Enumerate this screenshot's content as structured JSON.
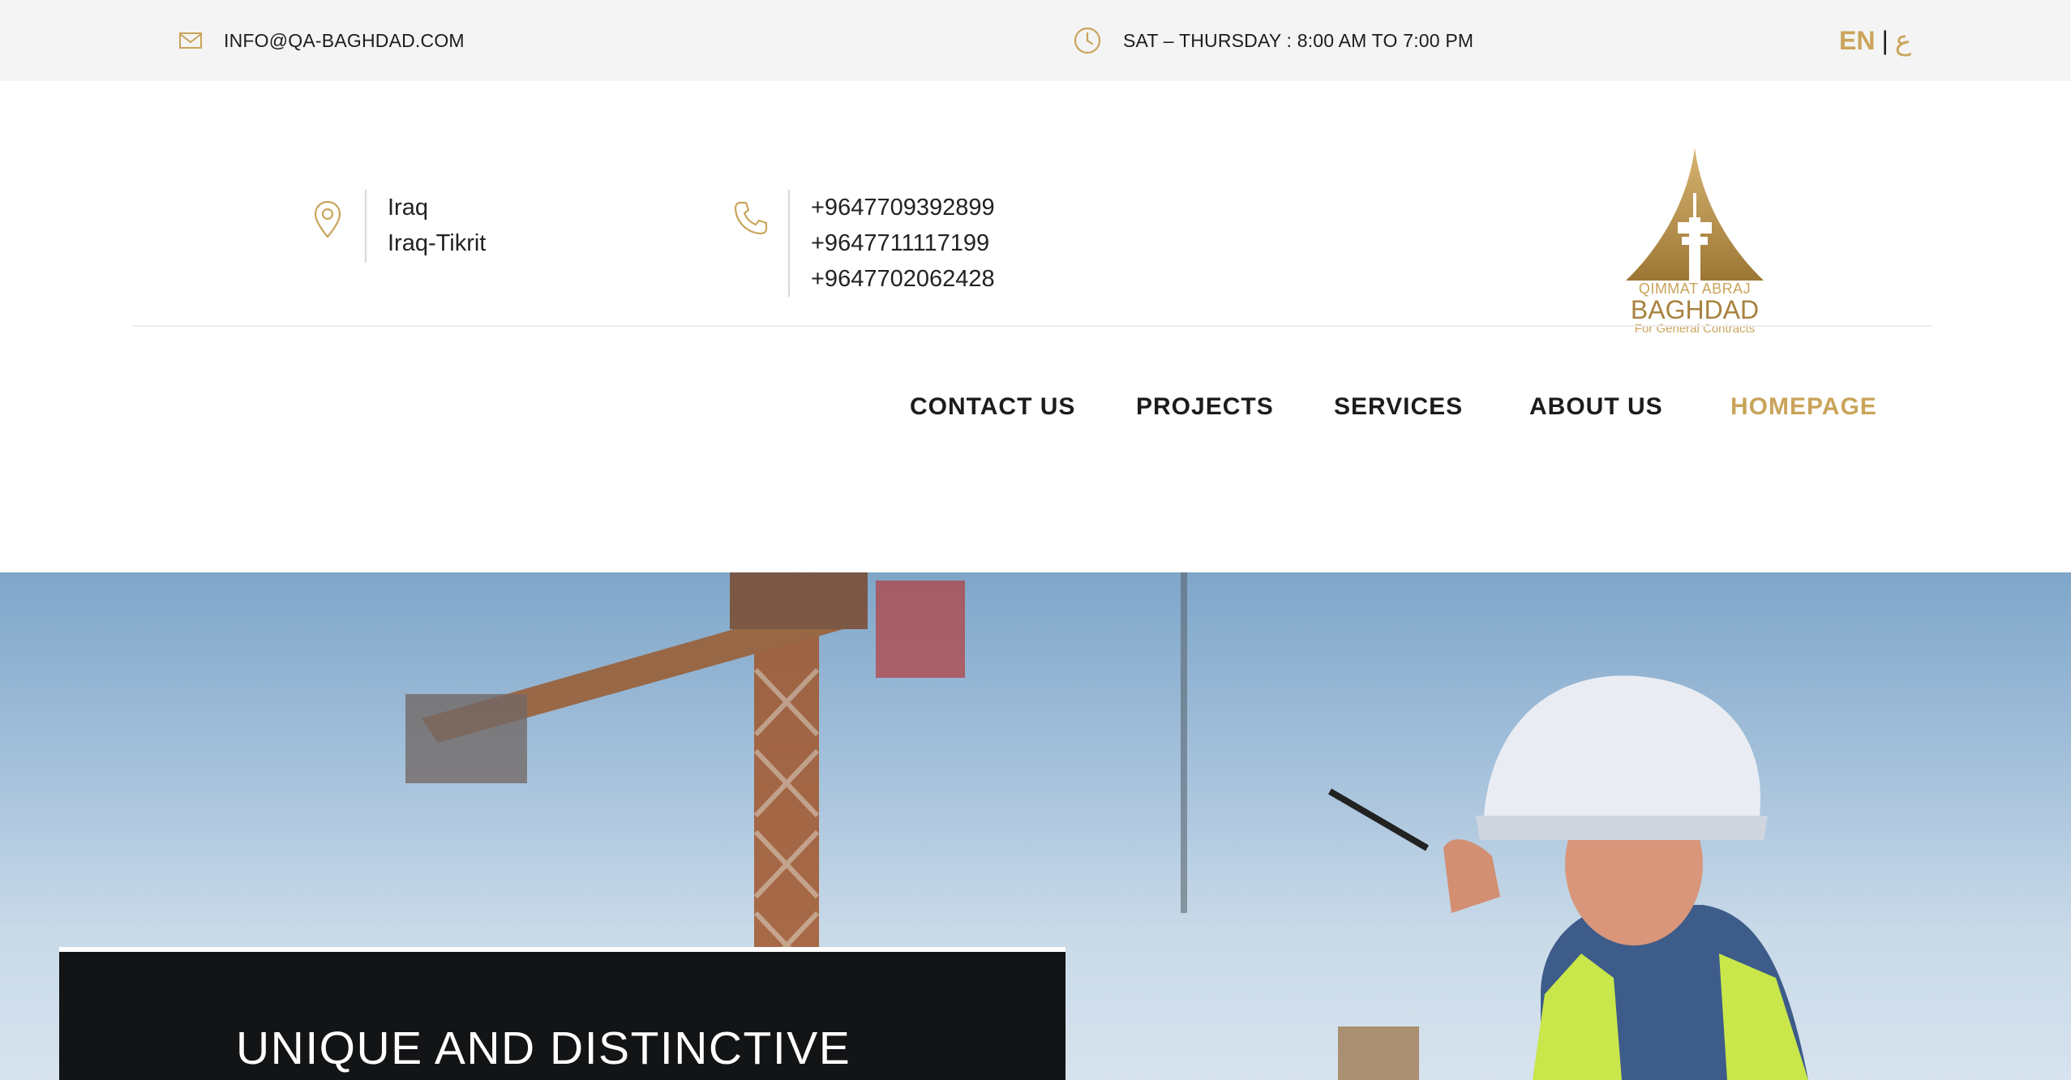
{
  "topbar": {
    "email": "INFO@QA-BAGHDAD.COM",
    "hours": "SAT – THURSDAY : 8:00 AM TO 7:00 PM",
    "lang_en": "EN",
    "lang_separator": "|",
    "lang_ar": "ع",
    "icons": {
      "email": "envelope-icon",
      "hours": "clock-icon"
    }
  },
  "header": {
    "address": {
      "icon": "map-pin-icon",
      "lines": [
        "Iraq",
        "Iraq-Tikrit"
      ]
    },
    "phones": {
      "icon": "phone-icon",
      "lines": [
        "+9647709392899",
        "+9647711117199",
        "+9647702062428"
      ]
    },
    "logo": {
      "top": "QIMMAT ABRAJ",
      "main": "BAGHDAD",
      "sub": "For General Contracts"
    }
  },
  "nav": {
    "items": [
      {
        "label": "CONTACT US"
      },
      {
        "label": "PROJECTS"
      },
      {
        "label": "SERVICES"
      },
      {
        "label": "ABOUT US"
      },
      {
        "label": "HOMEPAGE",
        "active": true
      }
    ]
  },
  "hero": {
    "caption": "UNIQUE AND DISTINCTIVE"
  },
  "colors": {
    "accent": "#c9a45a",
    "topbar_bg": "#f4f4f4",
    "text_dark": "#1c1c1c",
    "caption_bg": "#121416"
  }
}
